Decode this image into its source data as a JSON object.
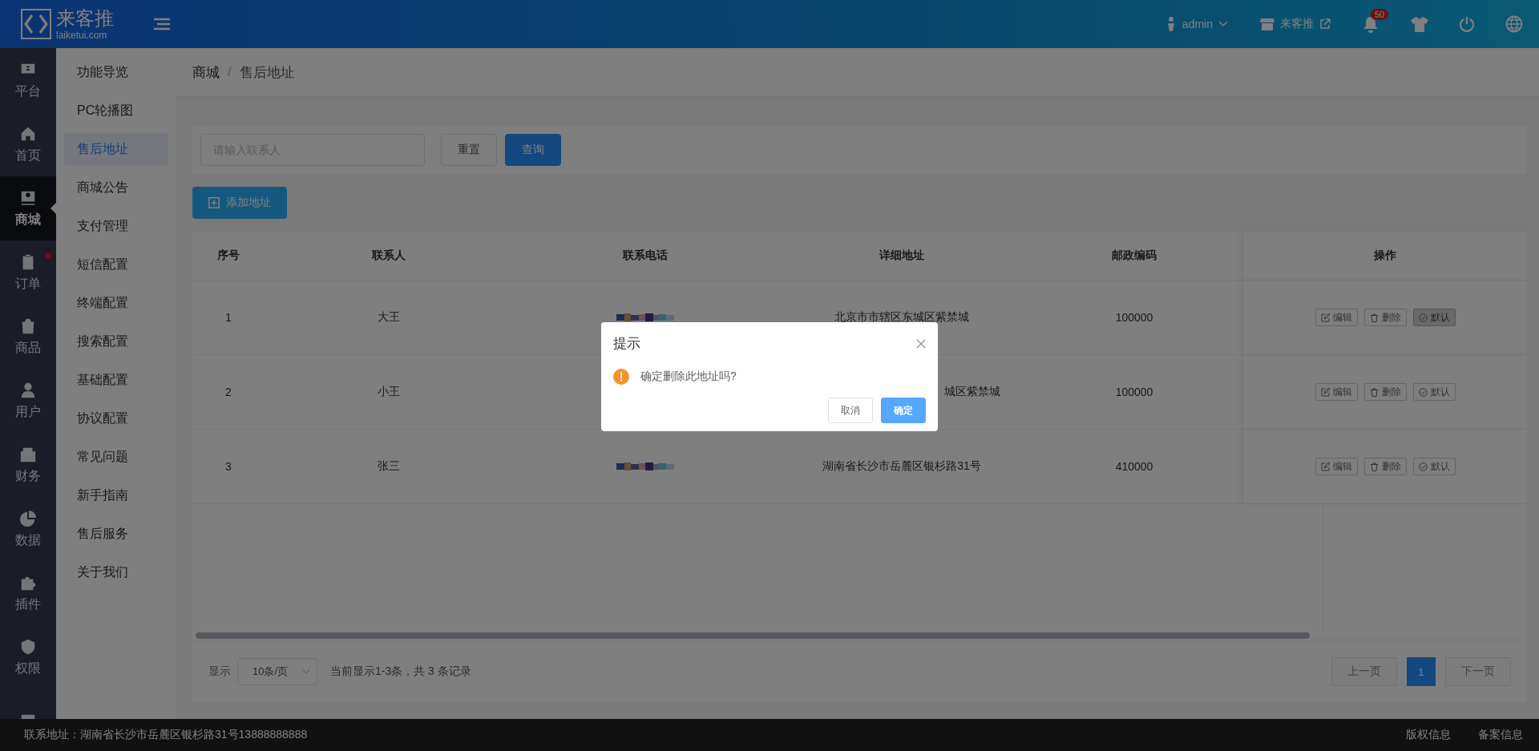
{
  "header": {
    "logo_text": "来客推",
    "logo_sub": "laiketui.com",
    "user": "admin",
    "store": "来客推",
    "notifications": "50"
  },
  "nav": [
    {
      "label": "平台",
      "selected": false,
      "dot": false
    },
    {
      "label": "首页",
      "selected": false,
      "dot": false
    },
    {
      "label": "商城",
      "selected": true,
      "dot": false
    },
    {
      "label": "订单",
      "selected": false,
      "dot": true
    },
    {
      "label": "商品",
      "selected": false,
      "dot": false
    },
    {
      "label": "用户",
      "selected": false,
      "dot": false
    },
    {
      "label": "财务",
      "selected": false,
      "dot": false
    },
    {
      "label": "数据",
      "selected": false,
      "dot": false
    },
    {
      "label": "插件",
      "selected": false,
      "dot": false
    },
    {
      "label": "权限",
      "selected": false,
      "dot": false
    },
    {
      "selected": false
    }
  ],
  "subnav": [
    {
      "label": "功能导览",
      "selected": false
    },
    {
      "label": "PC轮播图",
      "selected": false
    },
    {
      "label": "售后地址",
      "selected": true
    },
    {
      "label": "商城公告",
      "selected": false
    },
    {
      "label": "支付管理",
      "selected": false
    },
    {
      "label": "短信配置",
      "selected": false
    },
    {
      "label": "终端配置",
      "selected": false
    },
    {
      "label": "搜索配置",
      "selected": false
    },
    {
      "label": "基础配置",
      "selected": false
    },
    {
      "label": "协议配置",
      "selected": false
    },
    {
      "label": "常见问题",
      "selected": false
    },
    {
      "label": "新手指南",
      "selected": false
    },
    {
      "label": "售后服务",
      "selected": false
    },
    {
      "label": "关于我们",
      "selected": false
    }
  ],
  "breadcrumb": {
    "items": [
      "商城",
      "售后地址"
    ],
    "separator": "/"
  },
  "search": {
    "placeholder": "请输入联系人",
    "reset": "重置",
    "query": "查询"
  },
  "add_button": "添加地址",
  "table": {
    "columns": [
      "序号",
      "联系人",
      "联系电话",
      "详细地址",
      "邮政编码",
      "操作"
    ],
    "rows": [
      {
        "index": "1",
        "contact": "大王",
        "address": "北京市市辖区东城区紫禁城",
        "address_cut": false,
        "postcode": "100000",
        "actions": [
          "编辑",
          "删除",
          "默认"
        ],
        "default": true
      },
      {
        "index": "2",
        "contact": "小王",
        "address": "城区紫禁城",
        "address_cut": true,
        "postcode": "100000",
        "actions": [
          "编辑",
          "删除",
          "默认"
        ],
        "default": false
      },
      {
        "index": "3",
        "contact": "张三",
        "address": "湖南省长沙市岳麓区银杉路31号",
        "address_cut": false,
        "postcode": "410000",
        "actions": [
          "编辑",
          "删除",
          "默认"
        ],
        "default": false
      }
    ]
  },
  "pagination": {
    "show_label": "显示",
    "page_size": "10条/页",
    "summary": "当前显示1-3条，共 3 条记录",
    "prev": "上一页",
    "next": "下一页",
    "prev_disabled": true,
    "next_disabled": true,
    "pages": [
      {
        "label": "1",
        "selected": true
      }
    ]
  },
  "footer": {
    "address": "联系地址：湖南省长沙市岳麓区银杉路31号13888888888",
    "links": [
      "版权信息",
      "备案信息"
    ]
  },
  "dialog": {
    "title": "提示",
    "message": "确定删除此地址吗?",
    "cancel": "取消",
    "confirm": "确定"
  }
}
